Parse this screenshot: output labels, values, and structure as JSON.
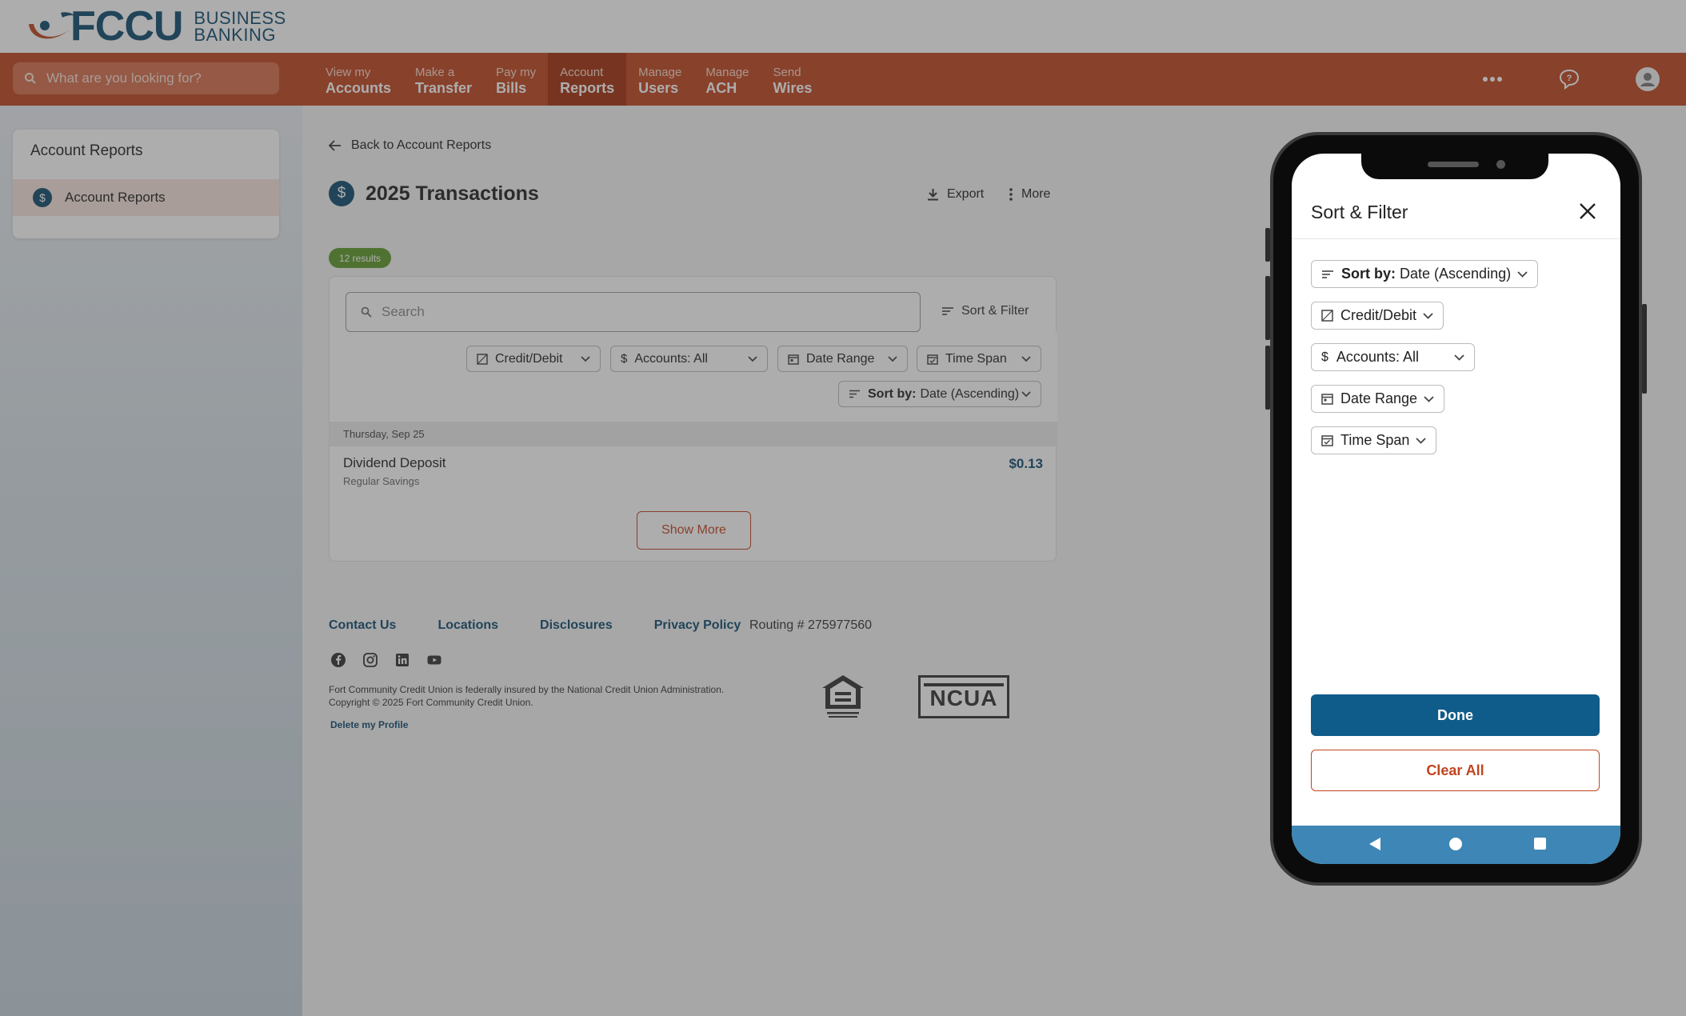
{
  "brand": {
    "name": "FCCU",
    "sub_line1": "BUSINESS",
    "sub_line2": "BANKING",
    "colors": {
      "navy": "#0f4a6e",
      "rust": "#c0451f",
      "green": "#5d9a2a"
    }
  },
  "nav": {
    "search_placeholder": "What are you looking for?",
    "items": [
      {
        "line1": "View my",
        "line2": "Accounts"
      },
      {
        "line1": "Make a",
        "line2": "Transfer"
      },
      {
        "line1": "Pay my",
        "line2": "Bills"
      },
      {
        "line1": "Account",
        "line2": "Reports"
      },
      {
        "line1": "Manage",
        "line2": "Users"
      },
      {
        "line1": "Manage",
        "line2": "ACH"
      },
      {
        "line1": "Send",
        "line2": "Wires"
      }
    ],
    "active_index": 3,
    "right_icons": [
      "more-horizontal-icon",
      "help-chat-icon",
      "user-avatar-icon"
    ]
  },
  "sidebar": {
    "title": "Account Reports",
    "items": [
      {
        "label": "Account Reports",
        "icon": "dollar-icon",
        "selected": true
      }
    ]
  },
  "main": {
    "back_label": "Back to Account Reports",
    "title": "2025 Transactions",
    "export_label": "Export",
    "more_label": "More",
    "results_badge": "12 results",
    "search_placeholder": "Search",
    "sort_filter_label": "Sort & Filter",
    "chips": {
      "credit_debit": "Credit/Debit",
      "accounts": "Accounts: All",
      "date_range": "Date Range",
      "time_span": "Time Span",
      "sort_prefix": "Sort by:",
      "sort_value": "Date (Ascending)"
    },
    "date_header": "Thursday, Sep 25",
    "transactions": [
      {
        "name": "Dividend Deposit",
        "account": "Regular Savings",
        "amount": "$0.13"
      }
    ],
    "show_more_label": "Show More"
  },
  "footer": {
    "links": [
      "Contact Us",
      "Locations",
      "Disclosures",
      "Privacy Policy"
    ],
    "routing": "Routing # 275977560",
    "social_icons": [
      "facebook-icon",
      "instagram-icon",
      "linkedin-icon",
      "youtube-icon"
    ],
    "legal_line1": "Fort Community Credit Union is federally insured by the National Credit Union Administration.",
    "legal_line2": "Copyright © 2025 Fort Community Credit Union.",
    "delete_profile": "Delete my Profile",
    "ncua_text": "NCUA"
  },
  "mobile_modal": {
    "title": "Sort & Filter",
    "sort_prefix": "Sort by:",
    "sort_value": "Date (Ascending)",
    "credit_debit": "Credit/Debit",
    "accounts": "Accounts: All",
    "date_range": "Date Range",
    "time_span": "Time Span",
    "done_label": "Done",
    "clear_label": "Clear All"
  }
}
